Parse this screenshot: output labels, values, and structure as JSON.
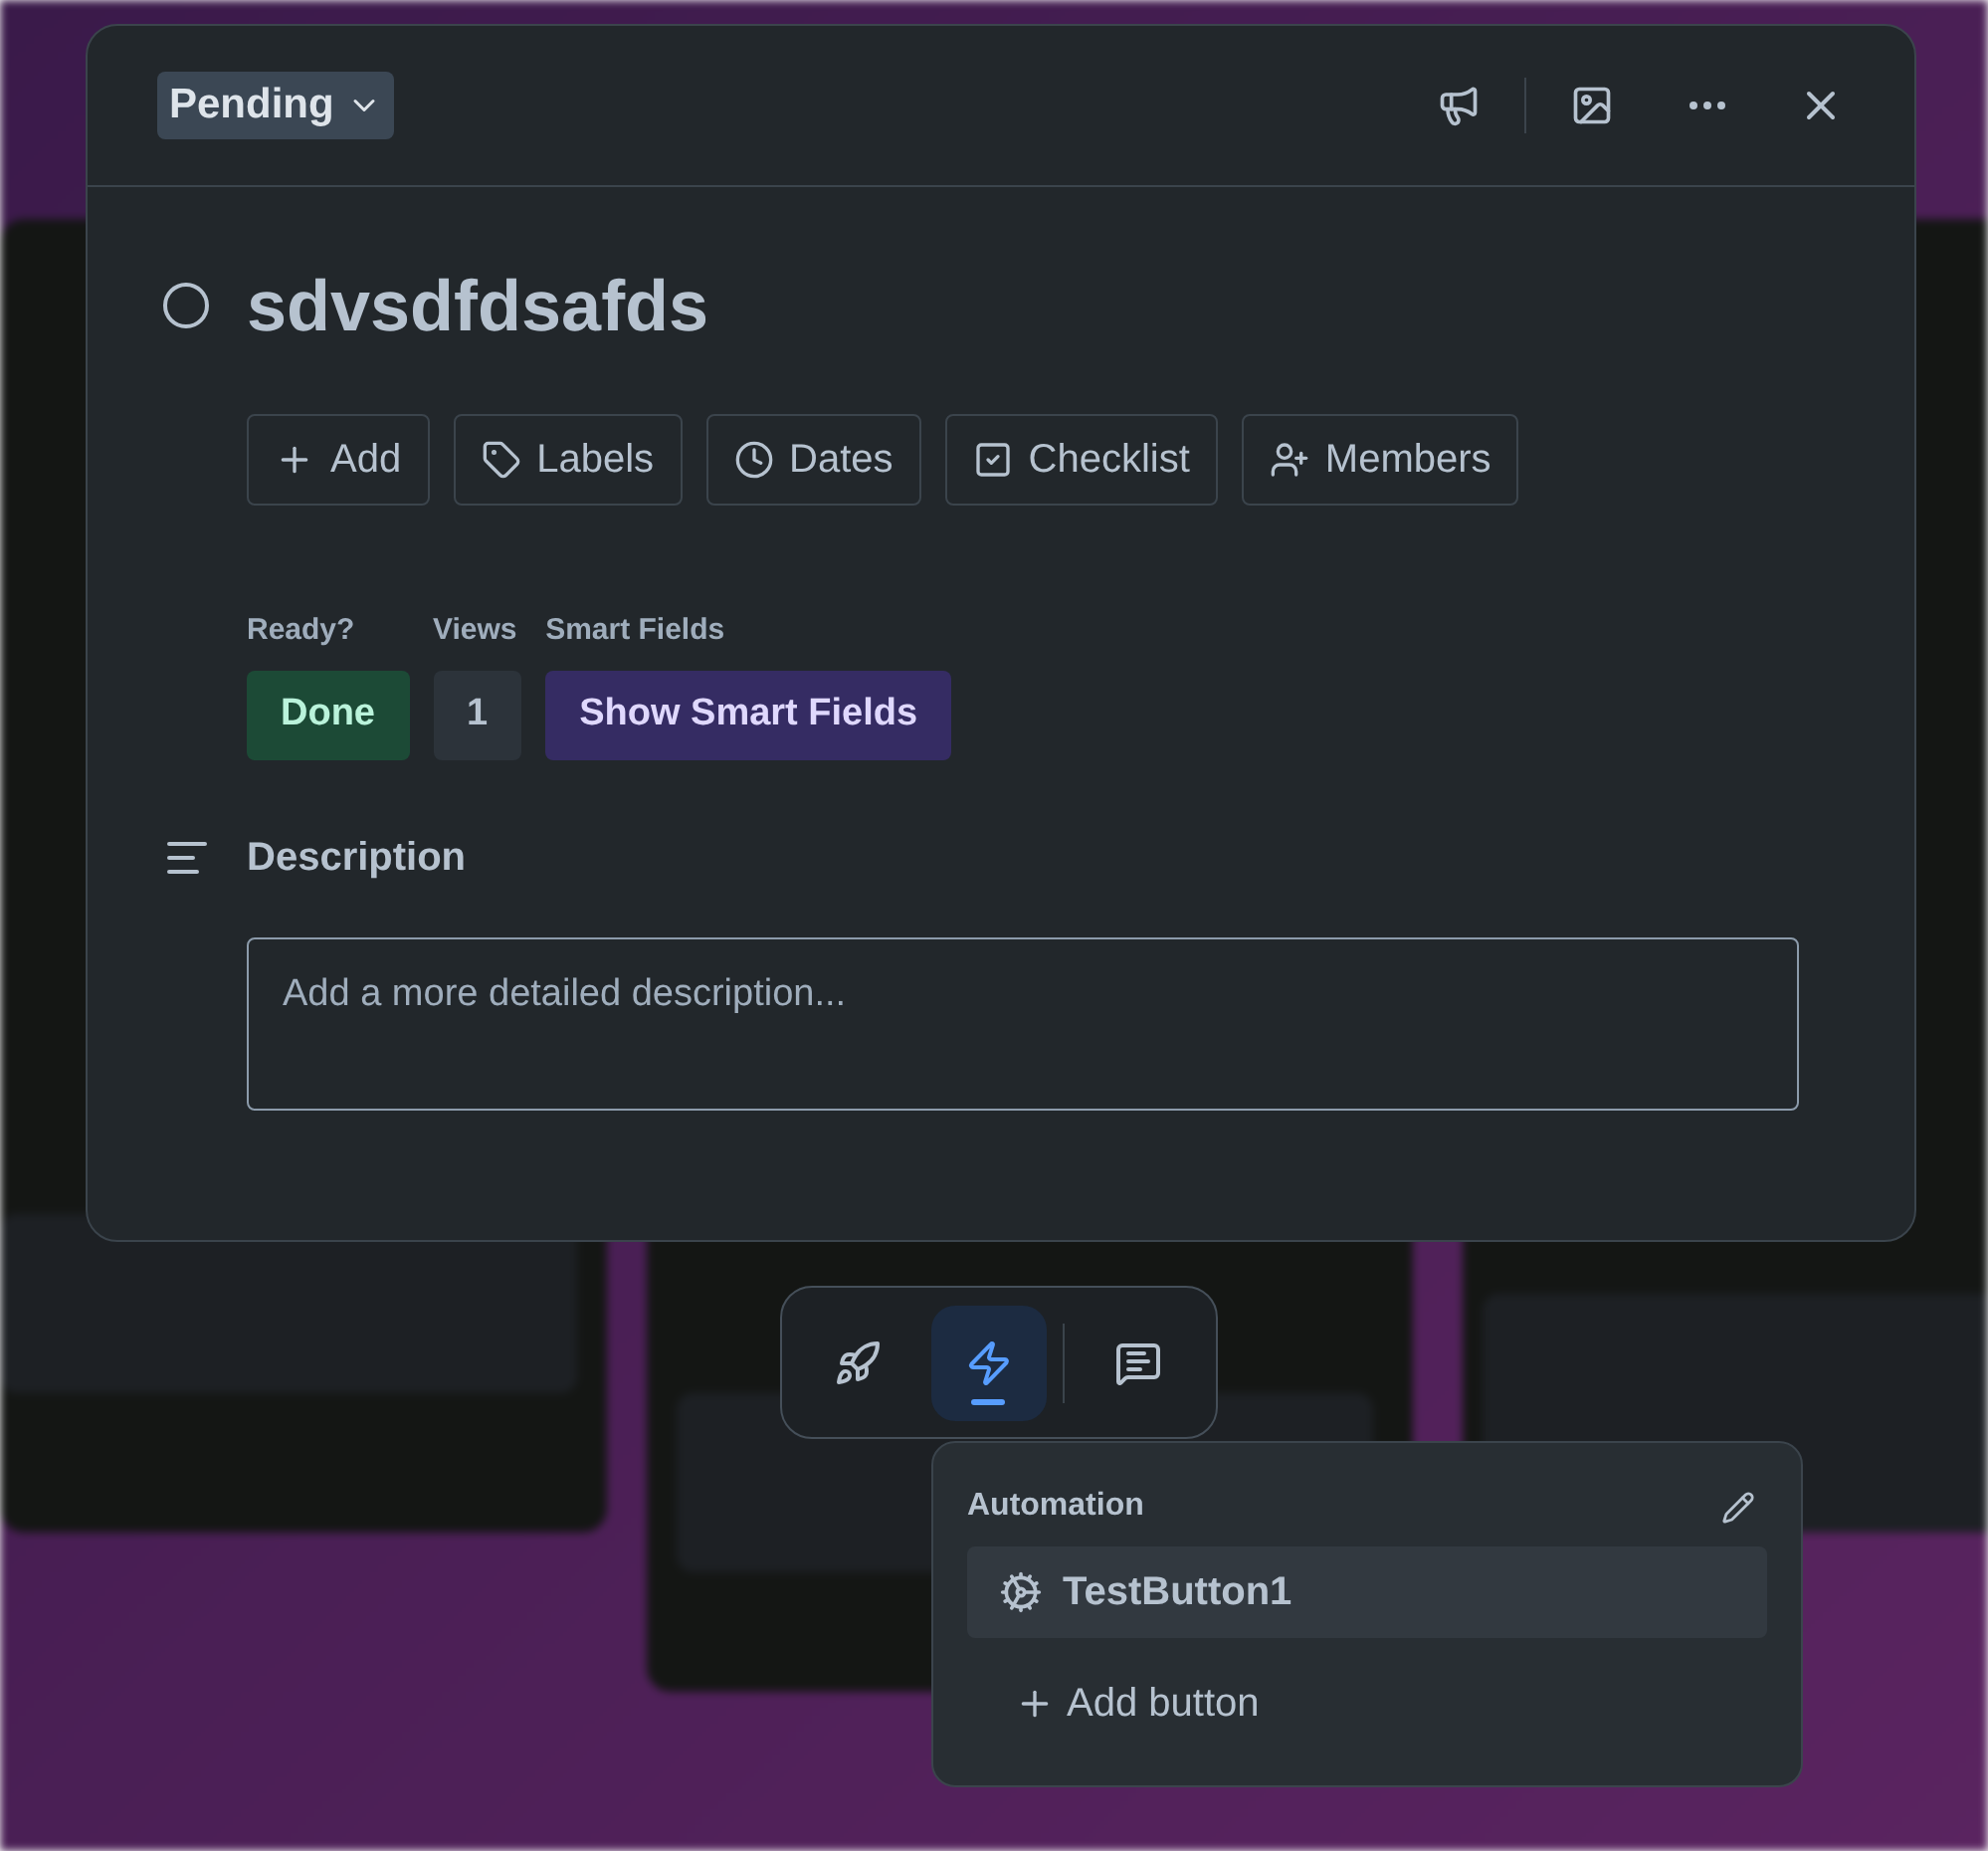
{
  "status_menu": {
    "label": "Pending"
  },
  "card": {
    "title": "sdvsdfdsafds",
    "completed": false
  },
  "actions": [
    {
      "label": "Add"
    },
    {
      "label": "Labels"
    },
    {
      "label": "Dates"
    },
    {
      "label": "Checklist"
    },
    {
      "label": "Members"
    }
  ],
  "fields": [
    {
      "label": "Ready?",
      "value": "Done",
      "kind": "status"
    },
    {
      "label": "Views",
      "value": "1",
      "kind": "count"
    },
    {
      "label": "Smart Fields",
      "value": "Show Smart Fields",
      "kind": "action"
    }
  ],
  "description": {
    "heading": "Description",
    "placeholder": "Add a more detailed description..."
  },
  "dock": {
    "tabs": [
      {
        "selected": false
      },
      {
        "selected": true
      },
      {
        "selected": false
      }
    ]
  },
  "automation": {
    "title": "Automation",
    "buttons": [
      {
        "label": "TestButton1"
      }
    ],
    "add_label": "Add button"
  }
}
